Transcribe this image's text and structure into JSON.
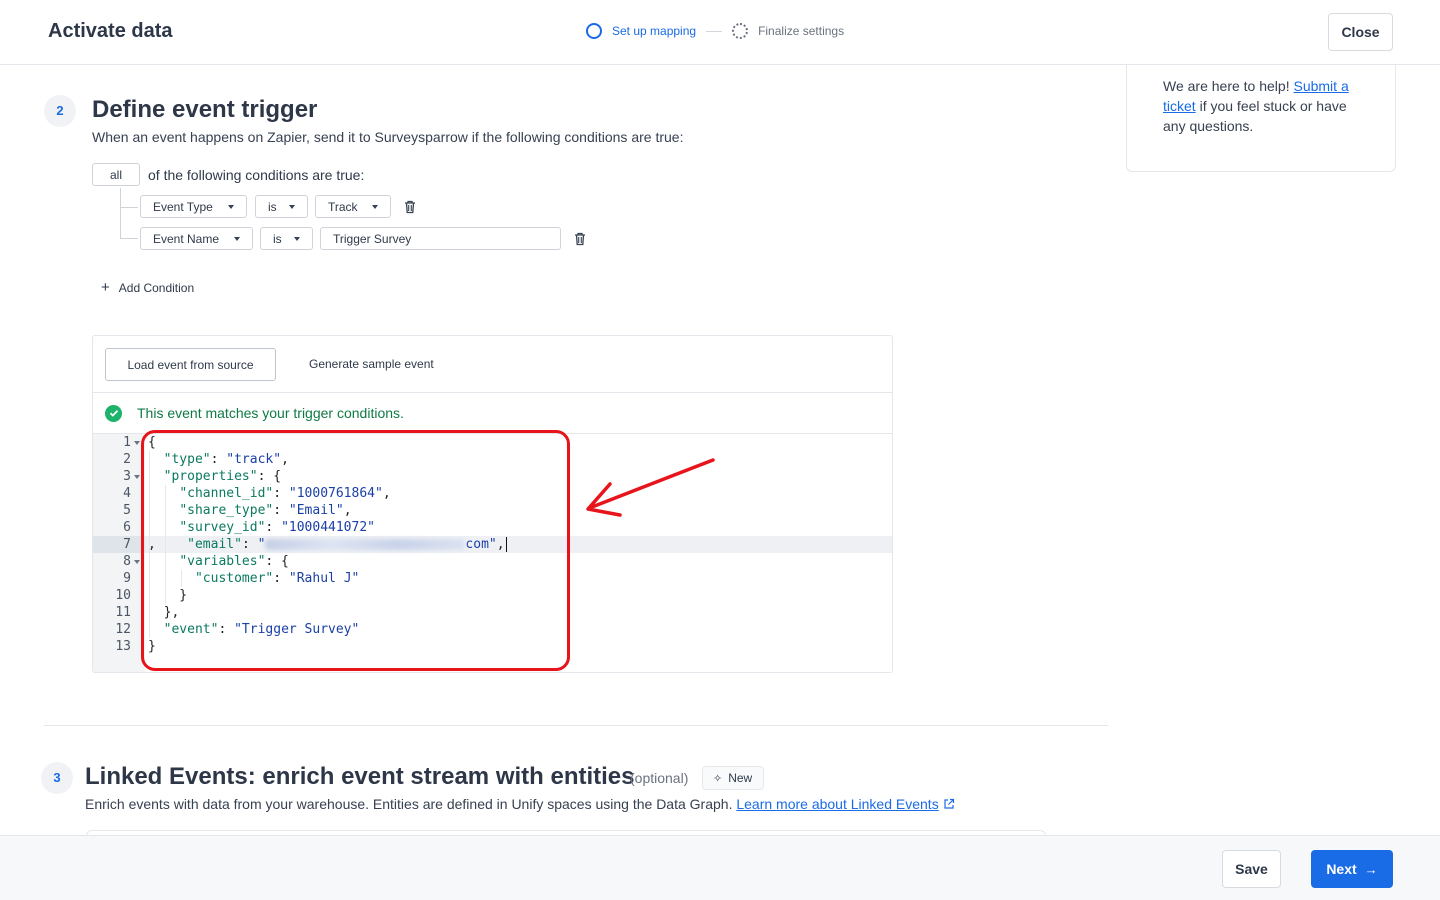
{
  "header": {
    "title": "Activate data",
    "steps": [
      {
        "label": "Set up mapping"
      },
      {
        "label": "Finalize settings"
      }
    ],
    "close_label": "Close"
  },
  "help": {
    "text_before": "We are here to help! ",
    "link_text": "Submit a ticket",
    "text_after": " if you feel stuck or have any questions."
  },
  "trigger": {
    "step_number": "2",
    "title": "Define event trigger",
    "description": "When an event happens on Zapier, send it to Surveysparrow if the following conditions are true:",
    "match_mode": "all",
    "match_suffix": "of the following conditions are true:",
    "conditions": [
      {
        "field": "Event Type",
        "operator": "is",
        "value": "Track"
      },
      {
        "field": "Event Name",
        "operator": "is",
        "value": "Trigger Survey"
      }
    ],
    "add_condition_label": "Add Condition"
  },
  "event_panel": {
    "load_label": "Load event from source",
    "generate_label": "Generate sample event",
    "match_message": "This event matches your trigger conditions.",
    "line_numbers": [
      "1",
      "2",
      "3",
      "4",
      "5",
      "6",
      "7",
      "8",
      "9",
      "10",
      "11",
      "12",
      "13"
    ],
    "code": {
      "l1": "{",
      "l2_key": "\"type\"",
      "l2_val": "\"track\"",
      "l3_key": "\"properties\"",
      "l4_key": "\"channel_id\"",
      "l4_val": "\"1000761864\"",
      "l5_key": "\"share_type\"",
      "l5_val": "\"Email\"",
      "l6_key": "\"survey_id\"",
      "l6_val": "\"1000441072\"",
      "l7_key": "\"email\"",
      "l7_val_end": "com\"",
      "l8_key": "\"variables\"",
      "l9_key": "\"customer\"",
      "l9_val": "\"Rahul J\"",
      "l12_key": "\"event\"",
      "l12_val": "\"Trigger Survey\""
    }
  },
  "linked": {
    "step_number": "3",
    "title": "Linked Events: enrich event stream with entities",
    "optional_label": "(optional)",
    "badge_label": "New",
    "description": "Enrich events with data from your warehouse. Entities are defined in Unify spaces using the Data Graph. ",
    "link_text": "Learn more about Linked Events"
  },
  "footer": {
    "save_label": "Save",
    "next_label": "Next"
  },
  "colors": {
    "accent": "#1a6be6",
    "success": "#1db36a",
    "annotation": "#e8141c"
  }
}
